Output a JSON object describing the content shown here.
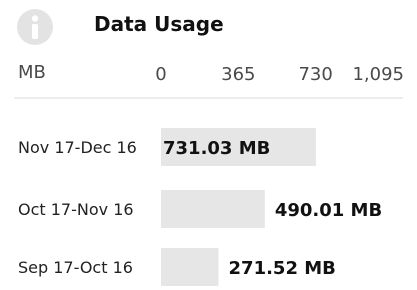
{
  "title": "Data Usage",
  "unit_label": "MB",
  "icon": "info-icon",
  "colors": {
    "bar": "#e6e6e6",
    "axis_line": "#d8d8d8",
    "icon": "#e3e3e3",
    "tick_text": "#4a4a4a"
  },
  "chart_data": {
    "type": "bar",
    "orientation": "horizontal",
    "title": "Data Usage",
    "xlabel": "MB",
    "ylabel": "",
    "categories": [
      "Nov 17-Dec 16",
      "Oct 17-Nov 16",
      "Sep 17-Oct 16"
    ],
    "values": [
      731.03,
      490.01,
      271.52
    ],
    "value_labels": [
      "731.03 MB",
      "490.01 MB",
      "271.52 MB"
    ],
    "xticks": [
      0,
      365,
      730,
      1095
    ],
    "xtick_labels": [
      "0",
      "365",
      "730",
      "1,095"
    ],
    "xlim": [
      0,
      1095
    ],
    "grid": false,
    "legend": "none"
  }
}
